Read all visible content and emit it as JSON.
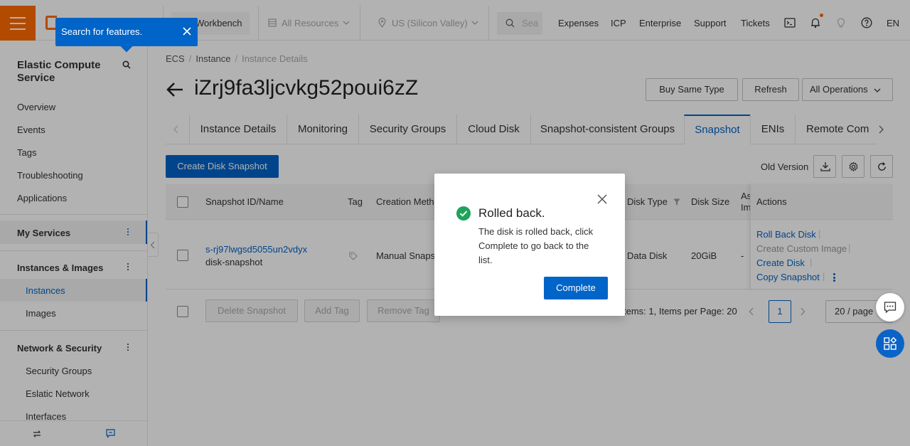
{
  "topbar": {
    "workbench": "Workbench",
    "resources": "All Resources",
    "region": "US (Silicon Valley)",
    "search_placeholder": "Sea",
    "links": [
      "Expenses",
      "ICP",
      "Enterprise",
      "Support",
      "Tickets"
    ],
    "language": "EN"
  },
  "tooltip": {
    "text": "Search for features."
  },
  "sidebar": {
    "title": "Elastic Compute Service",
    "items": [
      "Overview",
      "Events",
      "Tags",
      "Troubleshooting",
      "Applications"
    ],
    "my_services": "My Services",
    "group_instances": "Instances & Images",
    "instances_items": [
      "Instances",
      "Images"
    ],
    "group_network": "Network & Security",
    "network_items": [
      "Security Groups",
      "Eslatic Network",
      "Interfaces"
    ]
  },
  "main": {
    "breadcrumb": [
      "ECS",
      "Instance",
      "Instance Details"
    ],
    "title": "iZrj9fa3ljcvkg52poui6zZ",
    "buttons": {
      "buy_same": "Buy Same Type",
      "refresh": "Refresh",
      "all_ops": "All Operations"
    },
    "tabs": [
      "Instance Details",
      "Monitoring",
      "Security Groups",
      "Cloud Disk",
      "Snapshot-consistent Groups",
      "Snapshot",
      "ENIs",
      "Remote Comn"
    ],
    "active_tab": "Snapshot",
    "create_snapshot": "Create Disk Snapshot",
    "old_version": "Old Version",
    "table": {
      "headers": [
        "Snapshot ID/Name",
        "Tag",
        "Creation Meth",
        "Disk Type",
        "Disk Size",
        "As Im",
        "Actions"
      ],
      "row": {
        "id": "s-rj97lwgsd5055un2vdyx",
        "name": "disk-snapshot",
        "creation": "Manual Snapsh",
        "disk_type": "Data Disk",
        "disk_size": "20GiB",
        "as": "-",
        "actions": [
          "Roll Back Disk",
          "Create Custom Image",
          "Create Disk",
          "Copy Snapshot"
        ]
      }
    },
    "footer": {
      "delete": "Delete Snapshot",
      "add_tag": "Add Tag",
      "remove_tag": "Remove Tag",
      "summary": "tems: 1, Items per Page: 20",
      "page": "1",
      "page_size": "20 / page"
    }
  },
  "modal": {
    "title": "Rolled back.",
    "body": "The disk is rolled back, click Complete to go back to the list.",
    "button": "Complete"
  },
  "colors": {
    "accent": "#0064c8",
    "brand": "#ff6a00",
    "success": "#1ca45a"
  }
}
